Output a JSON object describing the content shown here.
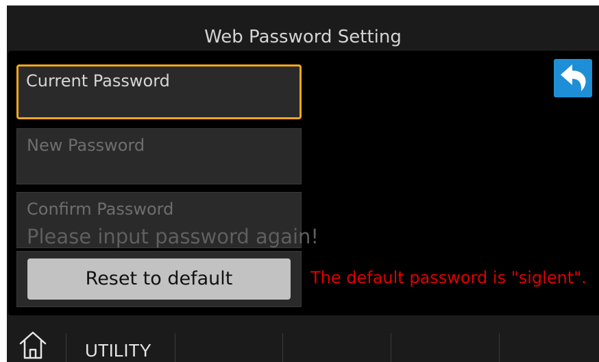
{
  "header": {
    "title": "Web Password Setting"
  },
  "form": {
    "current_password": {
      "label": "Current Password",
      "value": "",
      "focused": true
    },
    "new_password": {
      "label": "New Password",
      "value": "",
      "enabled": false
    },
    "confirm_password": {
      "label": "Confirm Password",
      "hint": "Please input password again!",
      "enabled": false
    },
    "reset_button_label": "Reset to default",
    "default_note": "The default password is \"siglent\"."
  },
  "icons": {
    "back": "back-arrow-icon",
    "home": "home-icon"
  },
  "bottom_bar": {
    "menu_label": "UTILITY"
  },
  "colors": {
    "focus_border": "#f2a81d",
    "note_text": "#e00000",
    "back_button": "#1e8fd6",
    "reset_button": "#c2c2c2"
  }
}
